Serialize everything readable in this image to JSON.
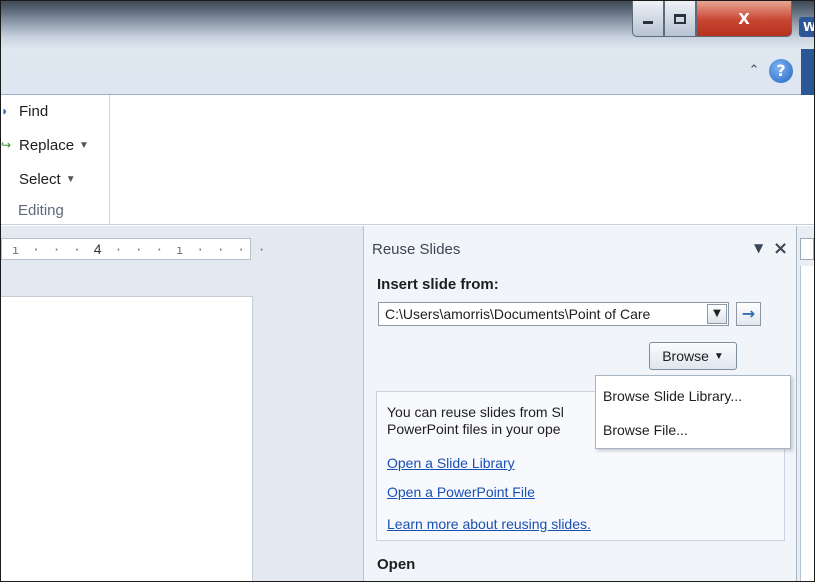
{
  "window": {
    "minimize_glyph": "",
    "maximize_glyph": "",
    "close_glyph": "X",
    "app_tab_letter": "W"
  },
  "ribbon_controls": {
    "collapse_glyph": "⌃",
    "help_glyph": "?"
  },
  "editing_group": {
    "find_label": "Find",
    "replace_label": "Replace",
    "select_label": "Select",
    "group_label": "Editing",
    "dropdown_glyph": "▼"
  },
  "ruler": {
    "ticks_left": "ı · · · ",
    "number": "4",
    "ticks_right": " · · · ı · · · ·"
  },
  "reuse_pane": {
    "title": "Reuse Slides",
    "menu_glyph": "▼",
    "close_glyph": "×",
    "insert_label": "Insert slide from:",
    "path_value": "C:\\Users\\amorris\\Documents\\Point of Care",
    "combo_arrow": "▼",
    "go_arrow": "→",
    "browse_label": "Browse",
    "browse_arrow": "▼",
    "info_line1": "You can reuse slides from Sl",
    "info_line2": "PowerPoint files in your ope",
    "link_library": "Open a Slide Library",
    "link_ppt": "Open a PowerPoint File",
    "link_learn": "Learn more about reusing slides.",
    "open_label": "Open"
  },
  "browse_menu": {
    "items": [
      "Browse Slide Library...",
      "Browse File..."
    ]
  },
  "icons": {
    "find": "binoculars-icon",
    "replace": "replace-icon",
    "select": "select-icon"
  }
}
